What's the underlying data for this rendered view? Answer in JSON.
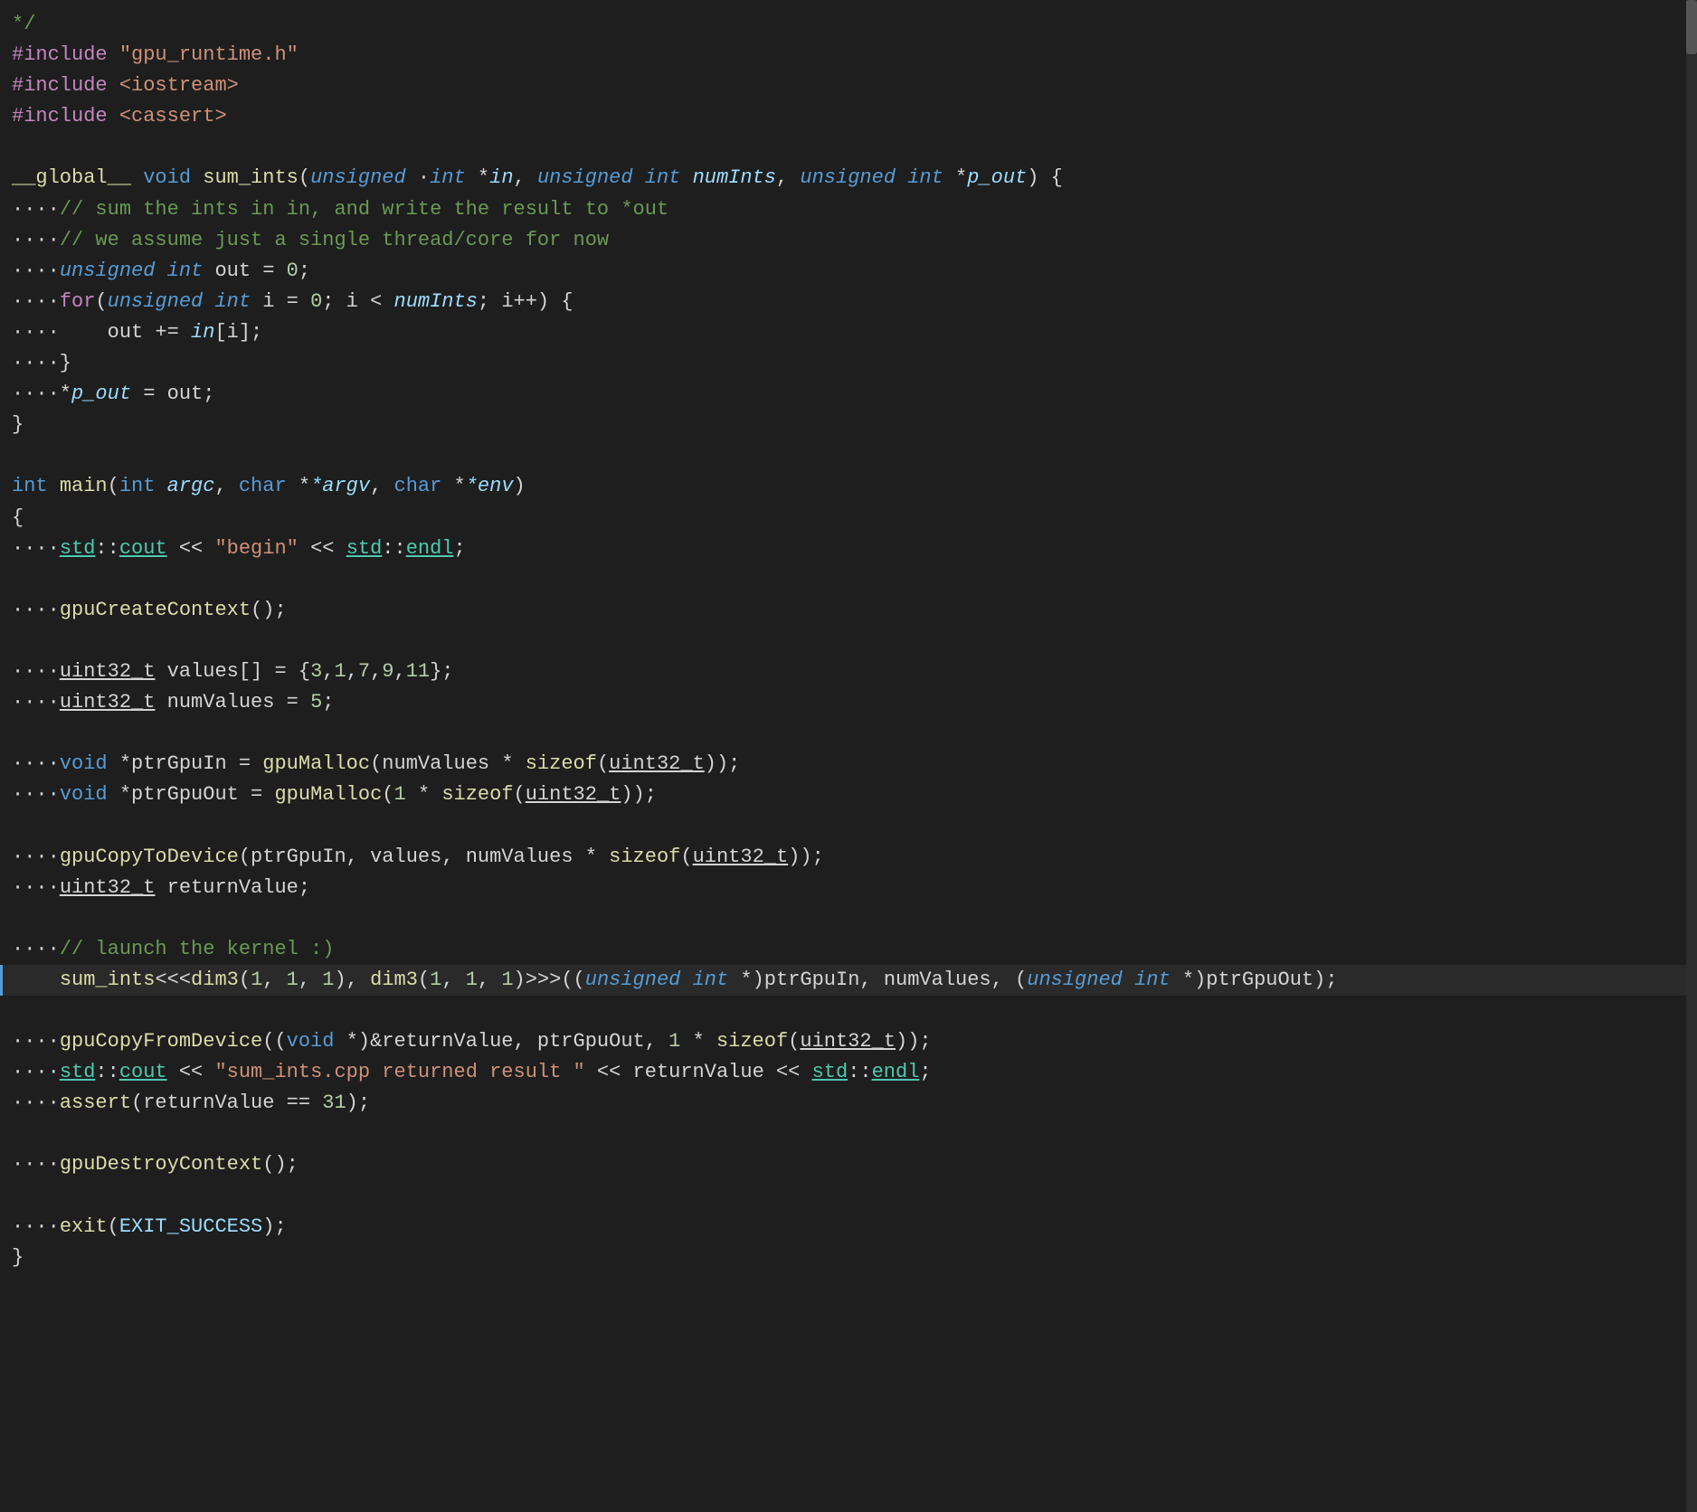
{
  "editor": {
    "background": "#1e1e1e",
    "lines": [
      {
        "id": 1,
        "content": "*/",
        "tokens": [
          {
            "text": "*/",
            "cls": "comment"
          }
        ]
      },
      {
        "id": 2,
        "content": "#include \"gpu_runtime.h\"",
        "tokens": [
          {
            "text": "#include",
            "cls": "preprocessor"
          },
          {
            "text": " ",
            "cls": "white"
          },
          {
            "text": "\"gpu_runtime.h\"",
            "cls": "str"
          }
        ]
      },
      {
        "id": 3,
        "content": "#include <iostream>",
        "tokens": [
          {
            "text": "#include",
            "cls": "preprocessor"
          },
          {
            "text": " ",
            "cls": "white"
          },
          {
            "text": "<iostream>",
            "cls": "str"
          }
        ]
      },
      {
        "id": 4,
        "content": "#include <cassert>",
        "tokens": [
          {
            "text": "#include",
            "cls": "preprocessor"
          },
          {
            "text": " ",
            "cls": "white"
          },
          {
            "text": "<cassert>",
            "cls": "str"
          }
        ]
      },
      {
        "id": 5,
        "content": "",
        "tokens": []
      },
      {
        "id": 6,
        "content": "__global__ void sum_ints(unsigned int *in, unsigned int numInts, unsigned int *p_out) {",
        "tokens": []
      },
      {
        "id": 7,
        "content": "    // sum the ints in in, and write the result to *out",
        "tokens": []
      },
      {
        "id": 8,
        "content": "    // we assume just a single thread/core for now",
        "tokens": []
      },
      {
        "id": 9,
        "content": "    unsigned int out = 0;",
        "tokens": []
      },
      {
        "id": 10,
        "content": "    for(unsigned int i = 0; i < numInts; i++) {",
        "tokens": []
      },
      {
        "id": 11,
        "content": "        out += in[i];",
        "tokens": []
      },
      {
        "id": 12,
        "content": "    }",
        "tokens": []
      },
      {
        "id": 13,
        "content": "    *p_out = out;",
        "tokens": []
      },
      {
        "id": 14,
        "content": "}",
        "tokens": []
      },
      {
        "id": 15,
        "content": "",
        "tokens": []
      },
      {
        "id": 16,
        "content": "int main(int argc, char **argv, char **env)",
        "tokens": []
      },
      {
        "id": 17,
        "content": "{",
        "tokens": []
      },
      {
        "id": 18,
        "content": "    std::cout << \"begin\" << std::endl;",
        "tokens": []
      },
      {
        "id": 19,
        "content": "",
        "tokens": []
      },
      {
        "id": 20,
        "content": "    gpuCreateContext();",
        "tokens": []
      },
      {
        "id": 21,
        "content": "",
        "tokens": []
      },
      {
        "id": 22,
        "content": "    uint32_t values[] = {3,1,7,9,11};",
        "tokens": []
      },
      {
        "id": 23,
        "content": "    uint32_t numValues = 5;",
        "tokens": []
      },
      {
        "id": 24,
        "content": "",
        "tokens": []
      },
      {
        "id": 25,
        "content": "    void *ptrGpuIn = gpuMalloc(numValues * sizeof(uint32_t));",
        "tokens": []
      },
      {
        "id": 26,
        "content": "    void *ptrGpuOut = gpuMalloc(1 * sizeof(uint32_t));",
        "tokens": []
      },
      {
        "id": 27,
        "content": "",
        "tokens": []
      },
      {
        "id": 28,
        "content": "    gpuCopyToDevice(ptrGpuIn, values, numValues * sizeof(uint32_t));",
        "tokens": []
      },
      {
        "id": 29,
        "content": "    uint32_t returnValue;",
        "tokens": []
      },
      {
        "id": 30,
        "content": "",
        "tokens": []
      },
      {
        "id": 31,
        "content": "    // launch the kernel :)",
        "tokens": []
      },
      {
        "id": 32,
        "content": "    sum_ints<<<dim3(1, 1, 1), dim3(1, 1, 1)>>>((unsigned int *)ptrGpuIn, numValues, (unsigned int *)ptrGpuOut);",
        "tokens": [],
        "highlighted": true
      },
      {
        "id": 33,
        "content": "",
        "tokens": []
      },
      {
        "id": 34,
        "content": "    gpuCopyFromDevice((void *)&returnValue, ptrGpuOut, 1 * sizeof(uint32_t));",
        "tokens": []
      },
      {
        "id": 35,
        "content": "    std::cout << \"sum_ints.cpp returned result \" << returnValue << std::endl;",
        "tokens": []
      },
      {
        "id": 36,
        "content": "    assert(returnValue == 31);",
        "tokens": []
      },
      {
        "id": 37,
        "content": "",
        "tokens": []
      },
      {
        "id": 38,
        "content": "    gpuDestroyContext();",
        "tokens": []
      },
      {
        "id": 39,
        "content": "",
        "tokens": []
      },
      {
        "id": 40,
        "content": "    exit(EXIT_SUCCESS);",
        "tokens": []
      },
      {
        "id": 41,
        "content": "}",
        "tokens": []
      }
    ]
  }
}
